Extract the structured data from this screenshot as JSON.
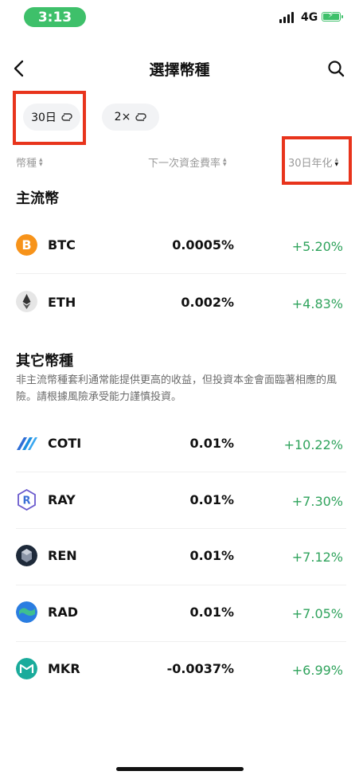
{
  "status_bar": {
    "time": "3:13",
    "network": "4G"
  },
  "header": {
    "title": "選擇幣種"
  },
  "chips": [
    {
      "label": "30日"
    },
    {
      "label": "2×"
    }
  ],
  "columns": {
    "coin": "幣種",
    "next_rate": "下一次資金費率",
    "annualized": "30日年化"
  },
  "sections": {
    "main": {
      "title": "主流幣"
    },
    "other": {
      "title": "其它幣種",
      "note": "非主流幣種套利通常能提供更高的收益，但投資本金會面臨著相應的風險。請根據風險承受能力謹慎投資。"
    }
  },
  "main_rows": [
    {
      "symbol": "BTC",
      "rate": "0.0005%",
      "apy": "+5.20%"
    },
    {
      "symbol": "ETH",
      "rate": "0.002%",
      "apy": "+4.83%"
    }
  ],
  "other_rows": [
    {
      "symbol": "COTI",
      "rate": "0.01%",
      "apy": "+10.22%"
    },
    {
      "symbol": "RAY",
      "rate": "0.01%",
      "apy": "+7.30%"
    },
    {
      "symbol": "REN",
      "rate": "0.01%",
      "apy": "+7.12%"
    },
    {
      "symbol": "RAD",
      "rate": "0.01%",
      "apy": "+7.05%"
    },
    {
      "symbol": "MKR",
      "rate": "-0.0037%",
      "apy": "+6.99%"
    }
  ],
  "icons": {
    "btc": "bitcoin-icon",
    "eth": "ethereum-icon",
    "coti": "coti-icon",
    "ray": "raydium-icon",
    "ren": "ren-icon",
    "rad": "radicle-icon",
    "mkr": "maker-icon",
    "loop": "loop-icon",
    "search": "search-icon",
    "back": "back-arrow-icon"
  },
  "colors": {
    "positive": "#2fa35c",
    "status_green": "#3ec06a",
    "highlight": "#e8341c"
  }
}
